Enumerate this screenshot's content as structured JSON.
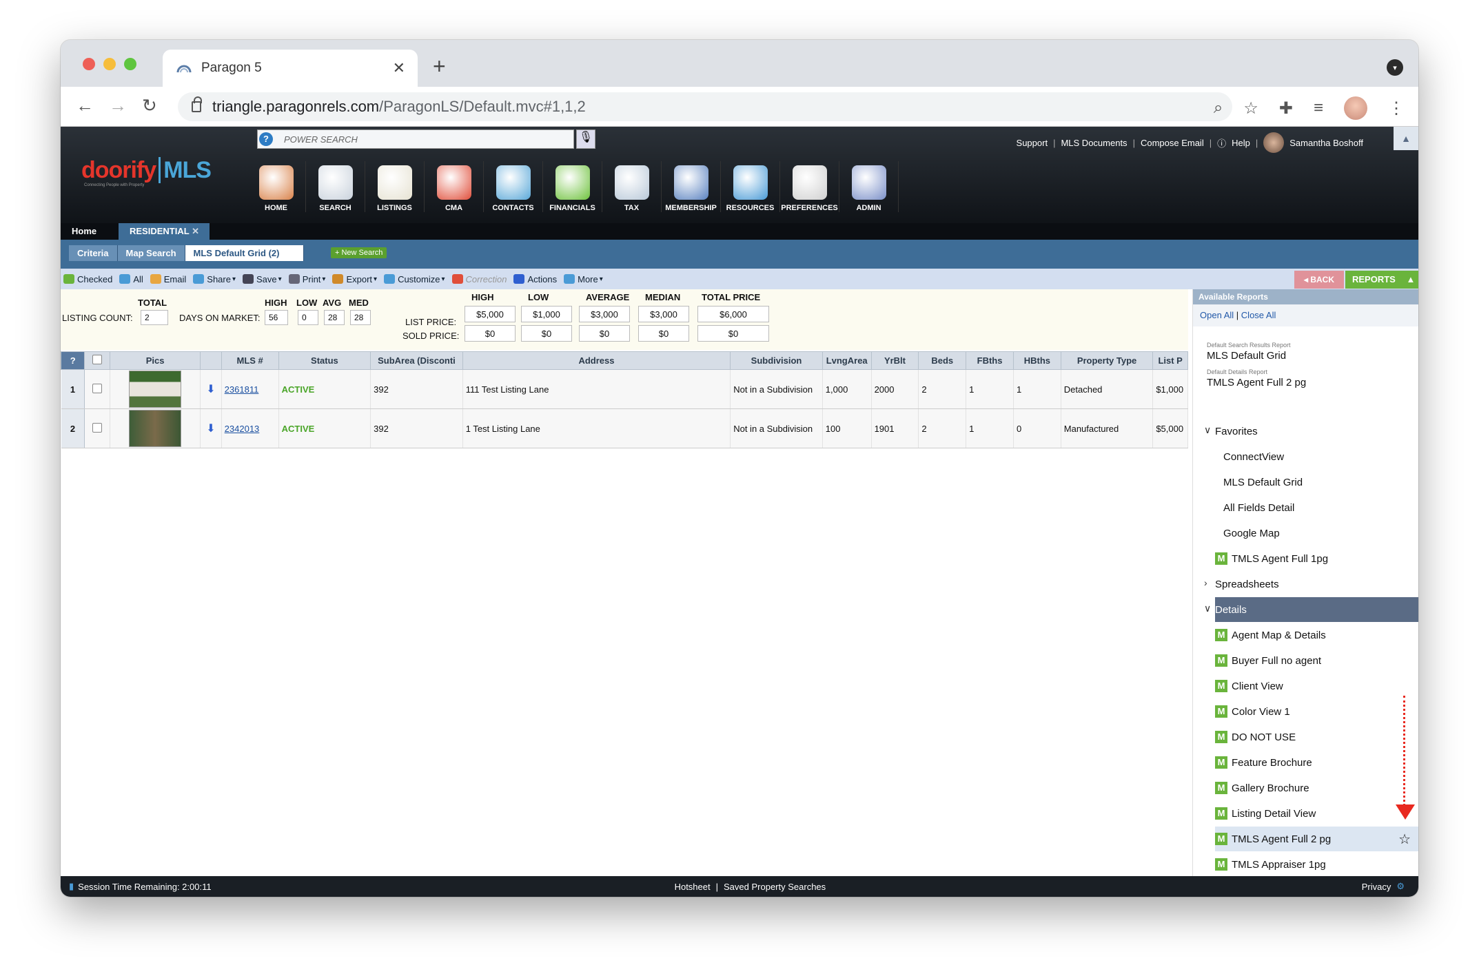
{
  "browser": {
    "tab_title": "Paragon 5",
    "url_host": "triangle.paragonrels.com",
    "url_path": "/ParagonLS/Default.mvc#1,1,2"
  },
  "header": {
    "power_search_placeholder": "POWER SEARCH",
    "links": [
      "Support",
      "MLS Documents",
      "Compose Email",
      "Help"
    ],
    "user_name": "Samantha Boshoff",
    "logo_a": "doorify",
    "logo_b": "MLS",
    "logo_tag": "Connecting People with Property",
    "menu": [
      "HOME",
      "SEARCH",
      "LISTINGS",
      "CMA",
      "CONTACTS",
      "FINANCIALS",
      "TAX",
      "MEMBERSHIP",
      "RESOURCES",
      "PREFERENCES",
      "ADMIN"
    ],
    "menu_colors": [
      "#d9824a",
      "#c9d2dc",
      "#e6e2d2",
      "#e04e3a",
      "#5aa8d8",
      "#6fc23e",
      "#b8c8d8",
      "#5a82c0",
      "#4a9bd6",
      "#d0d0d0",
      "#7a8fc8"
    ]
  },
  "tabs": {
    "home": "Home",
    "residential": "RESIDENTIAL"
  },
  "subtabs": {
    "criteria": "Criteria",
    "map_search": "Map Search",
    "grid": "MLS Default Grid (2)",
    "new_search": "+ New Search"
  },
  "actions": [
    {
      "label": "Checked",
      "color": "#6ab43c"
    },
    {
      "label": "All",
      "color": "#4a9bd6"
    },
    {
      "label": "Email",
      "color": "#e8a640"
    },
    {
      "label": "Share",
      "color": "#4a9bd6"
    },
    {
      "label": "Save",
      "color": "#445"
    },
    {
      "label": "Print",
      "color": "#667"
    },
    {
      "label": "Export",
      "color": "#d08a2a"
    },
    {
      "label": "Customize",
      "color": "#4a9bd6"
    },
    {
      "label": "Correction",
      "color": "#e04e3a"
    },
    {
      "label": "Actions",
      "color": "#2f5fd0"
    },
    {
      "label": "More",
      "color": "#4a9bd6"
    }
  ],
  "action_suffix": "▾",
  "back_label": "BACK",
  "reports_label": "REPORTS",
  "summary": {
    "total_label": "TOTAL",
    "listing_count_label": "LISTING COUNT:",
    "listing_count": "2",
    "dom_label": "DAYS ON MARKET:",
    "high_label": "HIGH",
    "low_label": "LOW",
    "avg_label": "AVG",
    "med_label": "MED",
    "dom_high": "56",
    "dom_low": "0",
    "dom_avg": "28",
    "dom_med": "28",
    "list_price_label": "LIST PRICE:",
    "sold_price_label": "SOLD PRICE:",
    "price_headers": [
      "HIGH",
      "LOW",
      "AVERAGE",
      "MEDIAN",
      "TOTAL PRICE"
    ],
    "list_prices": [
      "$5,000",
      "$1,000",
      "$3,000",
      "$3,000",
      "$6,000"
    ],
    "sold_prices": [
      "$0",
      "$0",
      "$0",
      "$0",
      "$0"
    ]
  },
  "grid": {
    "headers": [
      "?",
      "",
      "Pics",
      "",
      "MLS #",
      "Status",
      "SubArea (Disconti",
      "Address",
      "Subdivision",
      "LvngArea",
      "YrBlt",
      "Beds",
      "FBths",
      "HBths",
      "Property Type",
      "List P"
    ],
    "rows": [
      {
        "num": "1",
        "mls": "2361811",
        "status": "ACTIVE",
        "subarea": "392",
        "address": "111 Test Listing Lane",
        "subdivision": "Not in a Subdivision",
        "area": "1,000",
        "yr": "2000",
        "beds": "2",
        "fb": "1",
        "hb": "1",
        "type": "Detached",
        "price": "$1,000"
      },
      {
        "num": "2",
        "mls": "2342013",
        "status": "ACTIVE",
        "subarea": "392",
        "address": "1 Test Listing Lane",
        "subdivision": "Not in a Subdivision",
        "area": "100",
        "yr": "1901",
        "beds": "2",
        "fb": "1",
        "hb": "0",
        "type": "Manufactured",
        "price": "$5,000"
      }
    ]
  },
  "sidebar": {
    "title": "Available Reports",
    "open_all": "Open All",
    "close_all": "Close All",
    "default_search_label": "Default Search Results Report",
    "default_search": "MLS Default Grid",
    "default_details_label": "Default Details Report",
    "default_details": "TMLS Agent Full 2 pg",
    "favorites_label": "Favorites",
    "favorites": [
      "ConnectView",
      "MLS Default Grid",
      "All Fields Detail",
      "Google Map",
      "TMLS Agent Full 1pg"
    ],
    "spreadsheets_label": "Spreadsheets",
    "details_label": "Details",
    "details": [
      "Agent Map & Details",
      "Buyer Full no agent",
      "Client View",
      "Color View 1",
      "DO NOT USE",
      "Feature Brochure",
      "Gallery Brochure",
      "Listing Detail View",
      "TMLS Agent Full 2 pg",
      "TMLS Appraiser 1pg"
    ],
    "m_glyph": "M"
  },
  "footer": {
    "session": "Session Time Remaining: 2:00:11",
    "hotsheet": "Hotsheet",
    "saved": "Saved Property Searches",
    "privacy": "Privacy"
  }
}
